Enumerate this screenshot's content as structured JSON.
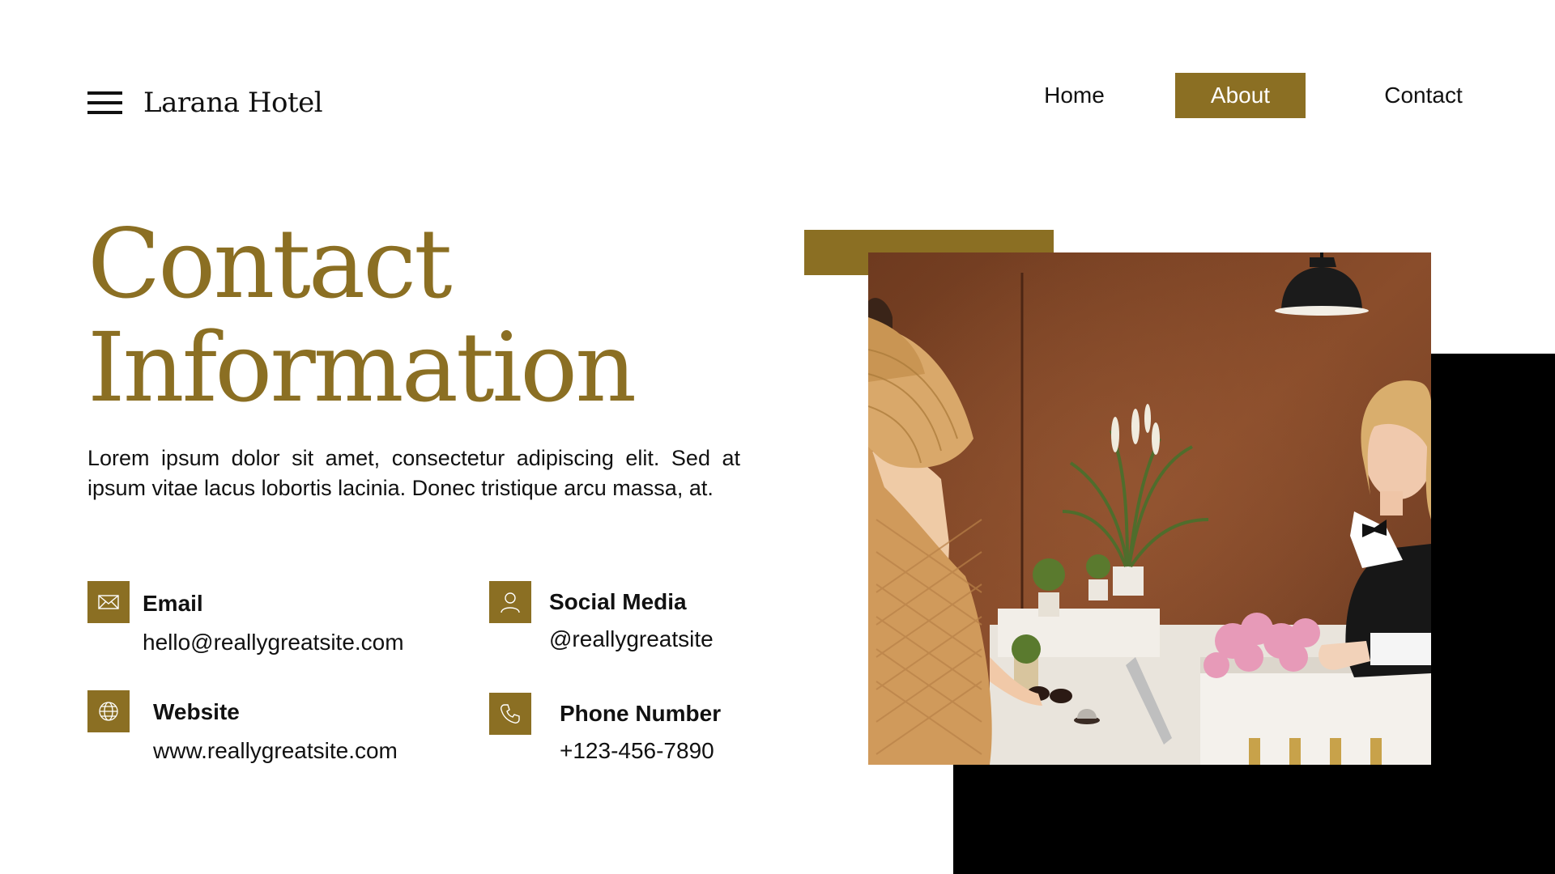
{
  "header": {
    "brand": "Larana Hotel",
    "nav": [
      {
        "label": "Home",
        "active": false
      },
      {
        "label": "About",
        "active": true
      },
      {
        "label": "Contact",
        "active": false
      }
    ]
  },
  "main": {
    "title_line1": "Contact",
    "title_line2": "Information",
    "intro": "Lorem ipsum dolor sit amet, consectetur adipiscing elit. Sed at ipsum vitae lacus lobortis lacinia. Donec tristique arcu massa, at."
  },
  "contacts": {
    "email": {
      "label": "Email",
      "value": "hello@reallygreatsite.com",
      "icon": "envelope-icon"
    },
    "social": {
      "label": "Social Media",
      "value": "@reallygreatsite",
      "icon": "user-icon"
    },
    "website": {
      "label": "Website",
      "value": "www.reallygreatsite.com",
      "icon": "globe-icon"
    },
    "phone": {
      "label": "Phone Number",
      "value": "+123-456-7890",
      "icon": "phone-icon"
    }
  },
  "colors": {
    "accent": "#8b6f23",
    "text": "#111111",
    "background": "#ffffff",
    "block": "#000000"
  }
}
